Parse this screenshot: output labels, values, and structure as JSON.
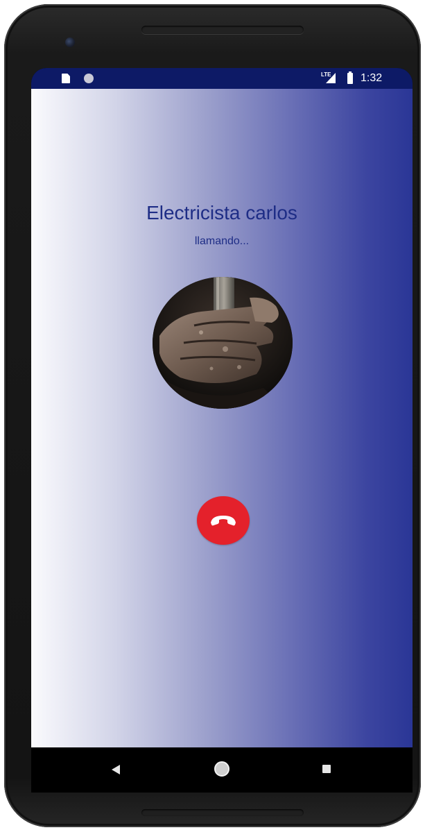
{
  "status_bar": {
    "network_label": "LTE",
    "time": "1:32",
    "icons": [
      "sd-card-icon",
      "notification-dot-icon",
      "signal-icon",
      "battery-icon"
    ]
  },
  "call": {
    "caller_name": "Electricista carlos",
    "status": "llamando...",
    "avatar_description": "photo-avatar",
    "end_call_icon": "phone-hangup-icon"
  },
  "colors": {
    "status_bar": "#0d1a66",
    "caller_text": "#1e2d86",
    "end_call": "#e4212b",
    "gradient_start": "#fafafd",
    "gradient_end": "#2a3696"
  },
  "navigation": {
    "icons": [
      "back-icon",
      "home-icon",
      "recents-icon"
    ]
  }
}
